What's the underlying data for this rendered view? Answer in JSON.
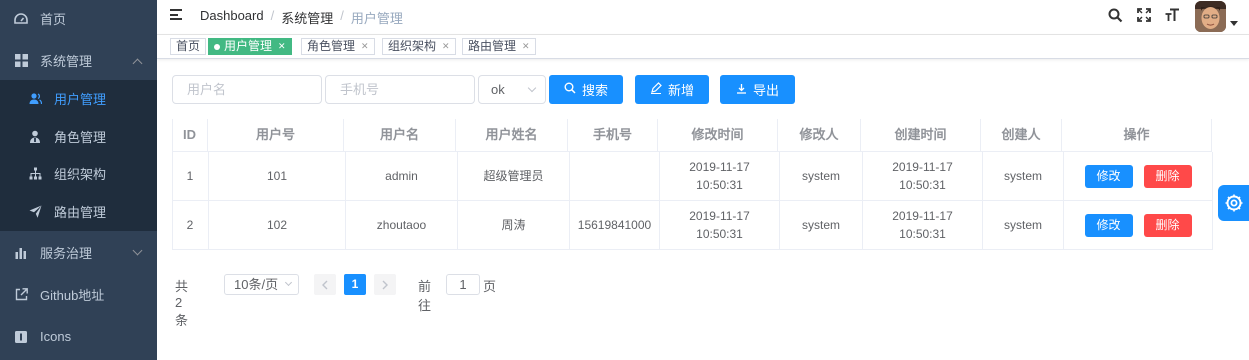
{
  "colors": {
    "sidebar_bg": "#304156",
    "sidebar_sub_bg": "#1f2d3d",
    "sidebar_text": "#bfcbd9",
    "active_menu": "#409eff",
    "active_tag": "#42b983",
    "primary": "#1890ff",
    "danger": "#ff4949"
  },
  "sidebar": {
    "items": [
      {
        "label": "首页",
        "icon": "dashboard-icon"
      },
      {
        "label": "系统管理",
        "icon": "grid-icon"
      },
      {
        "label": "用户管理",
        "icon": "user-icon"
      },
      {
        "label": "角色管理",
        "icon": "role-icon"
      },
      {
        "label": "组织架构",
        "icon": "org-tree-icon"
      },
      {
        "label": "路由管理",
        "icon": "send-icon"
      },
      {
        "label": "服务治理",
        "icon": "bar-chart-icon"
      },
      {
        "label": "Github地址",
        "icon": "external-link-icon"
      },
      {
        "label": "Icons",
        "icon": "info-icon"
      }
    ]
  },
  "navbar": {
    "breadcrumb": [
      "Dashboard",
      "系统管理",
      "用户管理"
    ],
    "icons": [
      "search-icon",
      "fullscreen-icon",
      "font-size-icon"
    ]
  },
  "tags": [
    {
      "label": "首页",
      "active": false,
      "closable": false
    },
    {
      "label": "用户管理",
      "active": true,
      "closable": true
    },
    {
      "label": "角色管理",
      "active": false,
      "closable": true
    },
    {
      "label": "组织架构",
      "active": false,
      "closable": true
    },
    {
      "label": "路由管理",
      "active": false,
      "closable": true
    }
  ],
  "toolbar": {
    "username_placeholder": "用户名",
    "phone_placeholder": "手机号",
    "status_value": "ok",
    "search_label": "搜索",
    "add_label": "新增",
    "export_label": "导出"
  },
  "table": {
    "columns": [
      "ID",
      "用户号",
      "用户名",
      "用户姓名",
      "手机号",
      "修改时间",
      "修改人",
      "创建时间",
      "创建人",
      "操作"
    ],
    "rows": [
      {
        "id": "1",
        "user_no": "101",
        "username": "admin",
        "name": "超级管理员",
        "phone": "",
        "updated_at": "2019-11-17 10:50:31",
        "updated_by": "system",
        "created_at": "2019-11-17 10:50:31",
        "created_by": "system"
      },
      {
        "id": "2",
        "user_no": "102",
        "username": "zhoutaoo",
        "name": "周涛",
        "phone": "15619841000",
        "updated_at": "2019-11-17 10:50:31",
        "updated_by": "system",
        "created_at": "2019-11-17 10:50:31",
        "created_by": "system"
      }
    ],
    "edit_label": "修改",
    "delete_label": "删除"
  },
  "pagination": {
    "total_text": "共 2 条",
    "page_size": "10条/页",
    "current_page": "1",
    "goto_label": "前往",
    "goto_value": "1",
    "page_suffix": "页"
  }
}
